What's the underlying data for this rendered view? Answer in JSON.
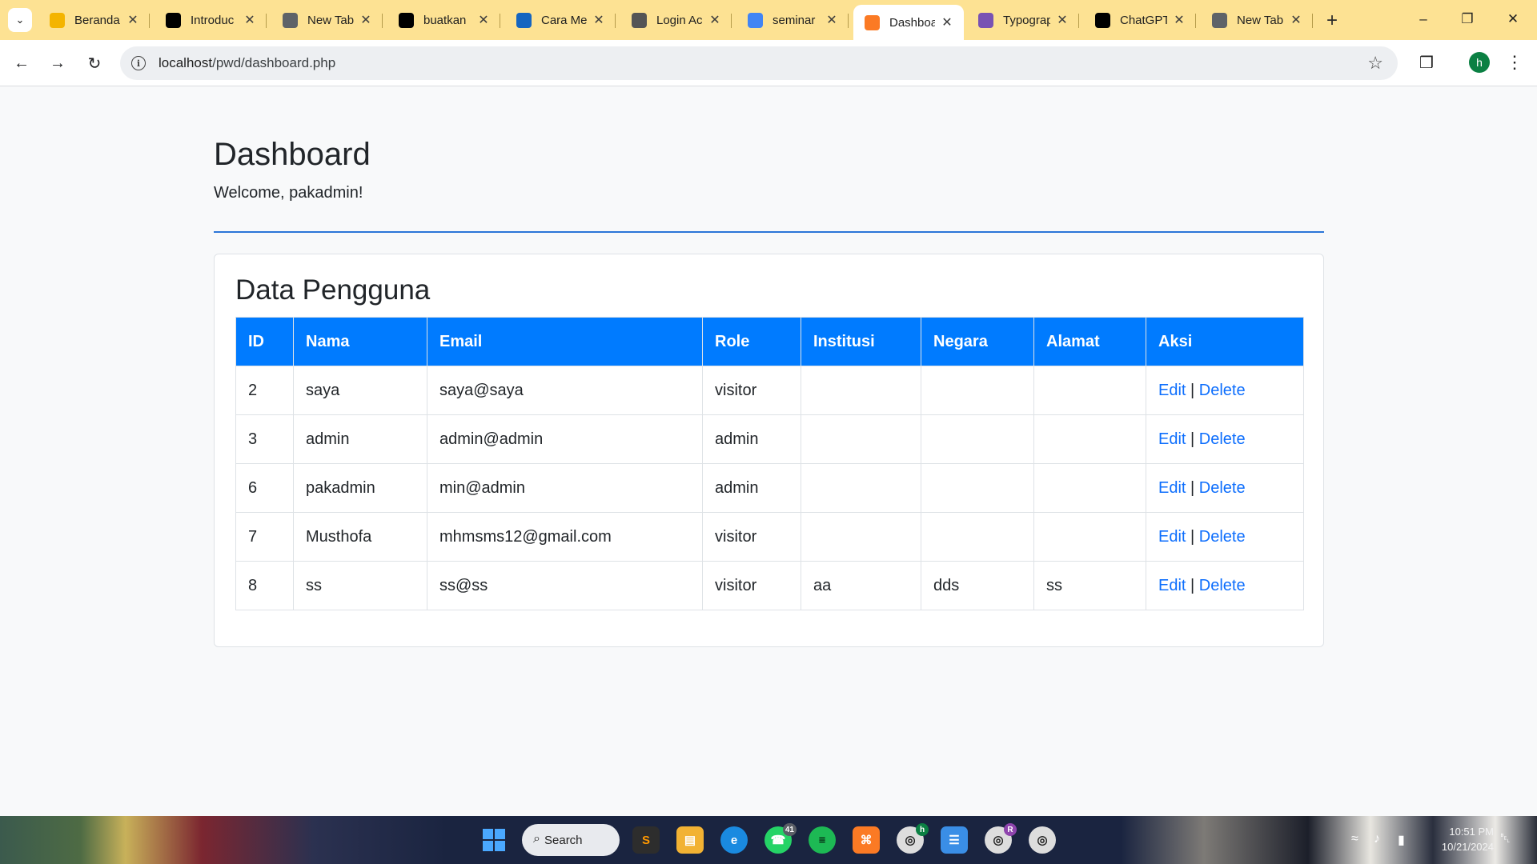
{
  "browser": {
    "tabs": [
      {
        "label": "Beranda",
        "icon": "google-drive-icon",
        "color": "#f4b400"
      },
      {
        "label": "Introduc",
        "icon": "openai-icon",
        "color": "#000000"
      },
      {
        "label": "New Tab",
        "icon": "chrome-icon",
        "color": "#5f6368"
      },
      {
        "label": "buatkan",
        "icon": "app-icon",
        "color": "#000000"
      },
      {
        "label": "Cara Me",
        "icon": "site-icon",
        "color": "#1565c0"
      },
      {
        "label": "Login Ac",
        "icon": "site-icon",
        "color": "#555555"
      },
      {
        "label": "seminar",
        "icon": "google-icon",
        "color": "#4285f4"
      },
      {
        "label": "Dashboa",
        "icon": "xampp-icon",
        "color": "#fb7a24",
        "active": true
      },
      {
        "label": "Typograp",
        "icon": "bootstrap-icon",
        "color": "#7952b3"
      },
      {
        "label": "ChatGPT",
        "icon": "openai-icon",
        "color": "#000000"
      },
      {
        "label": "New Tab",
        "icon": "chrome-icon",
        "color": "#5f6368"
      }
    ],
    "url_host": "localhost",
    "url_path": "/pwd/dashboard.php",
    "profile_initial": "h"
  },
  "page": {
    "title": "Dashboard",
    "welcome": "Welcome, pakadmin!",
    "card_title": "Data Pengguna",
    "table": {
      "headers": [
        "ID",
        "Nama",
        "Email",
        "Role",
        "Institusi",
        "Negara",
        "Alamat",
        "Aksi"
      ],
      "rows": [
        {
          "id": "2",
          "nama": "saya",
          "email": "saya@saya",
          "role": "visitor",
          "institusi": "",
          "negara": "",
          "alamat": ""
        },
        {
          "id": "3",
          "nama": "admin",
          "email": "admin@admin",
          "role": "admin",
          "institusi": "",
          "negara": "",
          "alamat": ""
        },
        {
          "id": "6",
          "nama": "pakadmin",
          "email": "min@admin",
          "role": "admin",
          "institusi": "",
          "negara": "",
          "alamat": ""
        },
        {
          "id": "7",
          "nama": "Musthofa",
          "email": "mhmsms12@gmail.com",
          "role": "visitor",
          "institusi": "",
          "negara": "",
          "alamat": ""
        },
        {
          "id": "8",
          "nama": "ss",
          "email": "ss@ss",
          "role": "visitor",
          "institusi": "aa",
          "negara": "dds",
          "alamat": "ss"
        }
      ],
      "edit_label": "Edit",
      "separator": "|",
      "delete_label": "Delete"
    },
    "colors": {
      "header_bg": "#007bff",
      "link": "#0d6efd",
      "divider": "#2b75d8"
    }
  },
  "taskbar": {
    "search_label": "Search",
    "whatsapp_badge": "41",
    "chrome_profile_h": "h",
    "chrome_profile_r": "R",
    "time": "10:51 PM",
    "date": "10/21/2024"
  }
}
